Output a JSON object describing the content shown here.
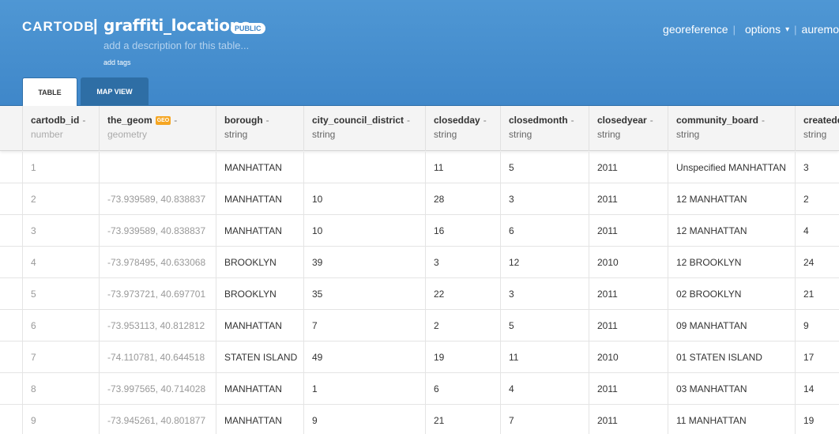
{
  "header": {
    "logo": "CARTODB",
    "separator": "|",
    "table_name": "graffiti_locations",
    "privacy_badge": "PUBLIC",
    "description_placeholder": "add a description for this table...",
    "add_tags_label": "add tags",
    "nav": {
      "georeference": "georeference",
      "options": "options",
      "user": "auremo",
      "sep": "|"
    }
  },
  "tabs": {
    "table": "TABLE",
    "map_view": "MAP VIEW"
  },
  "columns": [
    {
      "name": "cartodb_id",
      "type": "number"
    },
    {
      "name": "the_geom",
      "type": "geometry",
      "badge": "GEO"
    },
    {
      "name": "borough",
      "type": "string"
    },
    {
      "name": "city_council_district",
      "type": "string"
    },
    {
      "name": "closedday",
      "type": "string"
    },
    {
      "name": "closedmonth",
      "type": "string"
    },
    {
      "name": "closedyear",
      "type": "string"
    },
    {
      "name": "community_board",
      "type": "string"
    },
    {
      "name": "createdd",
      "type": "string"
    }
  ],
  "rows": [
    [
      "1",
      "",
      "MANHATTAN",
      "",
      "11",
      "5",
      "2011",
      "Unspecified MANHATTAN",
      "3"
    ],
    [
      "2",
      "-73.939589, 40.838837",
      "MANHATTAN",
      "10",
      "28",
      "3",
      "2011",
      "12 MANHATTAN",
      "2"
    ],
    [
      "3",
      "-73.939589, 40.838837",
      "MANHATTAN",
      "10",
      "16",
      "6",
      "2011",
      "12 MANHATTAN",
      "4"
    ],
    [
      "4",
      "-73.978495, 40.633068",
      "BROOKLYN",
      "39",
      "3",
      "12",
      "2010",
      "12 BROOKLYN",
      "24"
    ],
    [
      "5",
      "-73.973721, 40.697701",
      "BROOKLYN",
      "35",
      "22",
      "3",
      "2011",
      "02 BROOKLYN",
      "21"
    ],
    [
      "6",
      "-73.953113, 40.812812",
      "MANHATTAN",
      "7",
      "2",
      "5",
      "2011",
      "09 MANHATTAN",
      "9"
    ],
    [
      "7",
      "-74.110781, 40.644518",
      "STATEN ISLAND",
      "49",
      "19",
      "11",
      "2010",
      "01 STATEN ISLAND",
      "17"
    ],
    [
      "8",
      "-73.997565, 40.714028",
      "MANHATTAN",
      "1",
      "6",
      "4",
      "2011",
      "03 MANHATTAN",
      "14"
    ],
    [
      "9",
      "-73.945261, 40.801877",
      "MANHATTAN",
      "9",
      "21",
      "7",
      "2011",
      "11 MANHATTAN",
      "19"
    ]
  ],
  "colors": {
    "header_blue": "#4f97d4",
    "active_tab_bg": "#ffffff",
    "inactive_tab_bg": "#2e6ea5",
    "geo_badge": "#f5a623"
  }
}
